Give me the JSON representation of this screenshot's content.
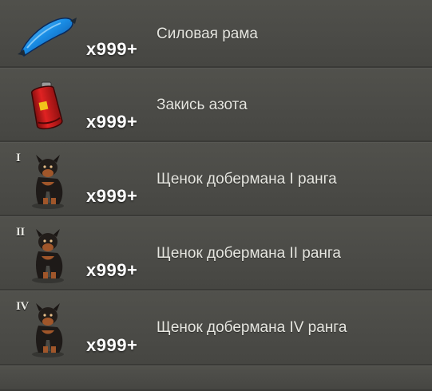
{
  "items": [
    {
      "name": "Силовая рама",
      "quantity": "x999+",
      "rank": "",
      "icon": "blue-frame-icon"
    },
    {
      "name": "Закись азота",
      "quantity": "x999+",
      "rank": "",
      "icon": "nitrous-tank-icon"
    },
    {
      "name": "Щенок добермана I ранга",
      "quantity": "x999+",
      "rank": "I",
      "icon": "doberman-puppy-icon"
    },
    {
      "name": "Щенок добермана II ранга",
      "quantity": "x999+",
      "rank": "II",
      "icon": "doberman-puppy-icon"
    },
    {
      "name": "Щенок добермана IV ранга",
      "quantity": "x999+",
      "rank": "IV",
      "icon": "doberman-puppy-icon"
    }
  ],
  "colors": {
    "row_background": "#4b4b47",
    "text": "#e6e6e0",
    "quantity": "#ffffff"
  }
}
